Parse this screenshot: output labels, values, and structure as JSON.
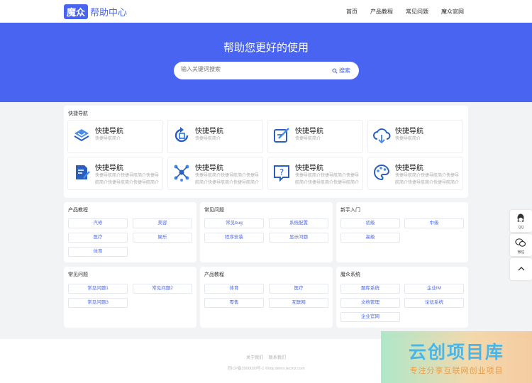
{
  "header": {
    "logo_box": "魔众",
    "logo_text": "帮助中心",
    "nav": [
      "首页",
      "产品教程",
      "常见问题",
      "魔众官网"
    ]
  },
  "hero": {
    "title": "帮助您更好的使用",
    "search_placeholder": "输入关键词搜索",
    "search_button": "搜索"
  },
  "quick_nav": {
    "title": "快捷导航",
    "items": [
      {
        "title": "快捷导航",
        "desc": "快捷导航简介",
        "icon": "layers-icon"
      },
      {
        "title": "快捷导航",
        "desc": "快捷导航简介",
        "icon": "refresh-icon"
      },
      {
        "title": "快捷导航",
        "desc": "快捷导航简介",
        "icon": "edit-icon"
      },
      {
        "title": "快捷导航",
        "desc": "快捷导航简介",
        "icon": "cloud-download-icon"
      },
      {
        "title": "快捷导航",
        "desc": "快捷导航简介快捷导航简介快捷导航简介快捷导航简介快捷导航简介",
        "icon": "document-edit-icon"
      },
      {
        "title": "快捷导航",
        "desc": "快捷导航简介快捷导航简介快捷导航简介快捷导航简介快捷导航简介",
        "icon": "network-icon"
      },
      {
        "title": "快捷导航",
        "desc": "快捷导航简介快捷导航简介快捷导航简介快捷导航简介快捷导航简介",
        "icon": "help-icon"
      },
      {
        "title": "快捷导航",
        "desc": "快捷导航简介快捷导航简介快捷导航简介快捷导航简介快捷导航简介",
        "icon": "palette-icon"
      }
    ]
  },
  "sections": [
    {
      "title": "产品教程",
      "tags": [
        "汽修",
        "美容",
        "医疗",
        "娱乐",
        "体育"
      ]
    },
    {
      "title": "常见问题",
      "tags": [
        "常见bug",
        "系统配置",
        "程序安装",
        "显示问题"
      ]
    },
    {
      "title": "新手入门",
      "tags": [
        "初级",
        "中级",
        "高级"
      ]
    },
    {
      "title": "常见问题",
      "tags": [
        "常见问题1",
        "常见问题2",
        "常见问题3"
      ]
    },
    {
      "title": "产品教程",
      "tags": [
        "体育",
        "医疗",
        "零售",
        "互联网"
      ]
    },
    {
      "title": "魔众系统",
      "tags": [
        "题库系统",
        "企业IM",
        "文档管理",
        "论坛系统",
        "企业官网"
      ]
    }
  ],
  "footer": {
    "links": [
      "关于我们",
      "联系我们"
    ],
    "copyright": "苏ICP备2000030号-1 ©tidy.demo.tecmz.com"
  },
  "side_tools": {
    "qq": "QQ",
    "wechat": "微信"
  },
  "watermark": {
    "title": "云创项目库",
    "subtitle": "专注分享互联网创业项目"
  },
  "colors": {
    "accent": "#4864f0",
    "background": "#f2f3f5"
  }
}
